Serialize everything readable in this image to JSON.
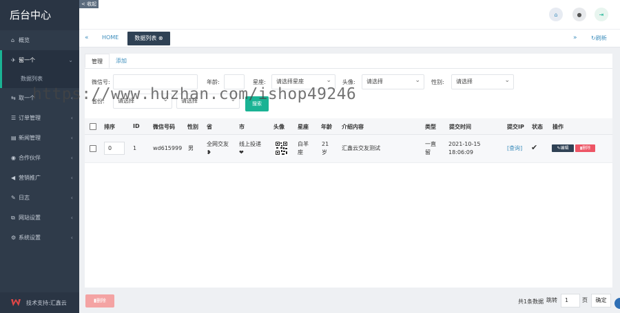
{
  "sidebar": {
    "brand": "后台中心",
    "items": [
      {
        "label": "概览",
        "icon": "home-icon"
      },
      {
        "label": "留一个",
        "icon": "send-icon"
      },
      {
        "label": "取一个",
        "icon": "share-icon"
      },
      {
        "label": "订单管理",
        "icon": "list-icon"
      },
      {
        "label": "新闻管理",
        "icon": "news-icon"
      },
      {
        "label": "合作伙伴",
        "icon": "eye-icon"
      },
      {
        "label": "营销推广",
        "icon": "bullhorn-icon"
      },
      {
        "label": "日志",
        "icon": "edit-icon"
      },
      {
        "label": "网站设置",
        "icon": "sitemap-icon"
      },
      {
        "label": "系统设置",
        "icon": "gear-icon"
      }
    ],
    "sub_item": "数据列表",
    "footer": "技术支持:汇鑫云"
  },
  "topbar": {
    "collapse": "< 收起"
  },
  "tabs": {
    "home": "HOME",
    "active": "数据列表",
    "refresh": "刷新"
  },
  "card_tabs": [
    "管理",
    "添加"
  ],
  "filters": {
    "wechat": "微信号:",
    "age": "年龄:",
    "constellation": "星座:",
    "constellation_value": "请选择星座",
    "avatar": "头像:",
    "avatar_value": "请选择",
    "gender": "性别:",
    "gender_value": "请选择",
    "province": "省份:",
    "province_value": "请选择",
    "city_value": "请选择",
    "search": "搜索"
  },
  "table": {
    "headers": [
      "排序",
      "ID",
      "微信号码",
      "性别",
      "省",
      "市",
      "头像",
      "星座",
      "年龄",
      "介绍内容",
      "类型",
      "提交时间",
      "提交IP",
      "状态",
      "操作"
    ],
    "row": {
      "order": "0",
      "id": "1",
      "wechat": "wd615999",
      "gender": "男",
      "province": [
        "全网交友",
        "❥"
      ],
      "city": [
        "线上投递",
        "❤"
      ],
      "constellation": [
        "白羊",
        "座"
      ],
      "age": [
        "21",
        "岁"
      ],
      "intro": "汇鑫云交友测试",
      "type": [
        "一直",
        "留"
      ],
      "time": [
        "2021-10-15",
        "18:06:09"
      ],
      "ip": "[查询]",
      "status": "✔",
      "edit": "编辑",
      "delete": "删除"
    }
  },
  "footer": {
    "bulk_delete": "删除",
    "total": "共1条数据",
    "jump": "跳转",
    "page_value": "1",
    "page_unit": "页",
    "confirm": "确定"
  },
  "watermark": "https://www.huzhan.com/ishop49246",
  "colors": {
    "sidebar": "#2f3b4a",
    "accent": "#1ab394",
    "danger": "#ed5565",
    "dark_button": "#2f4154",
    "link": "#3c8dbc"
  }
}
